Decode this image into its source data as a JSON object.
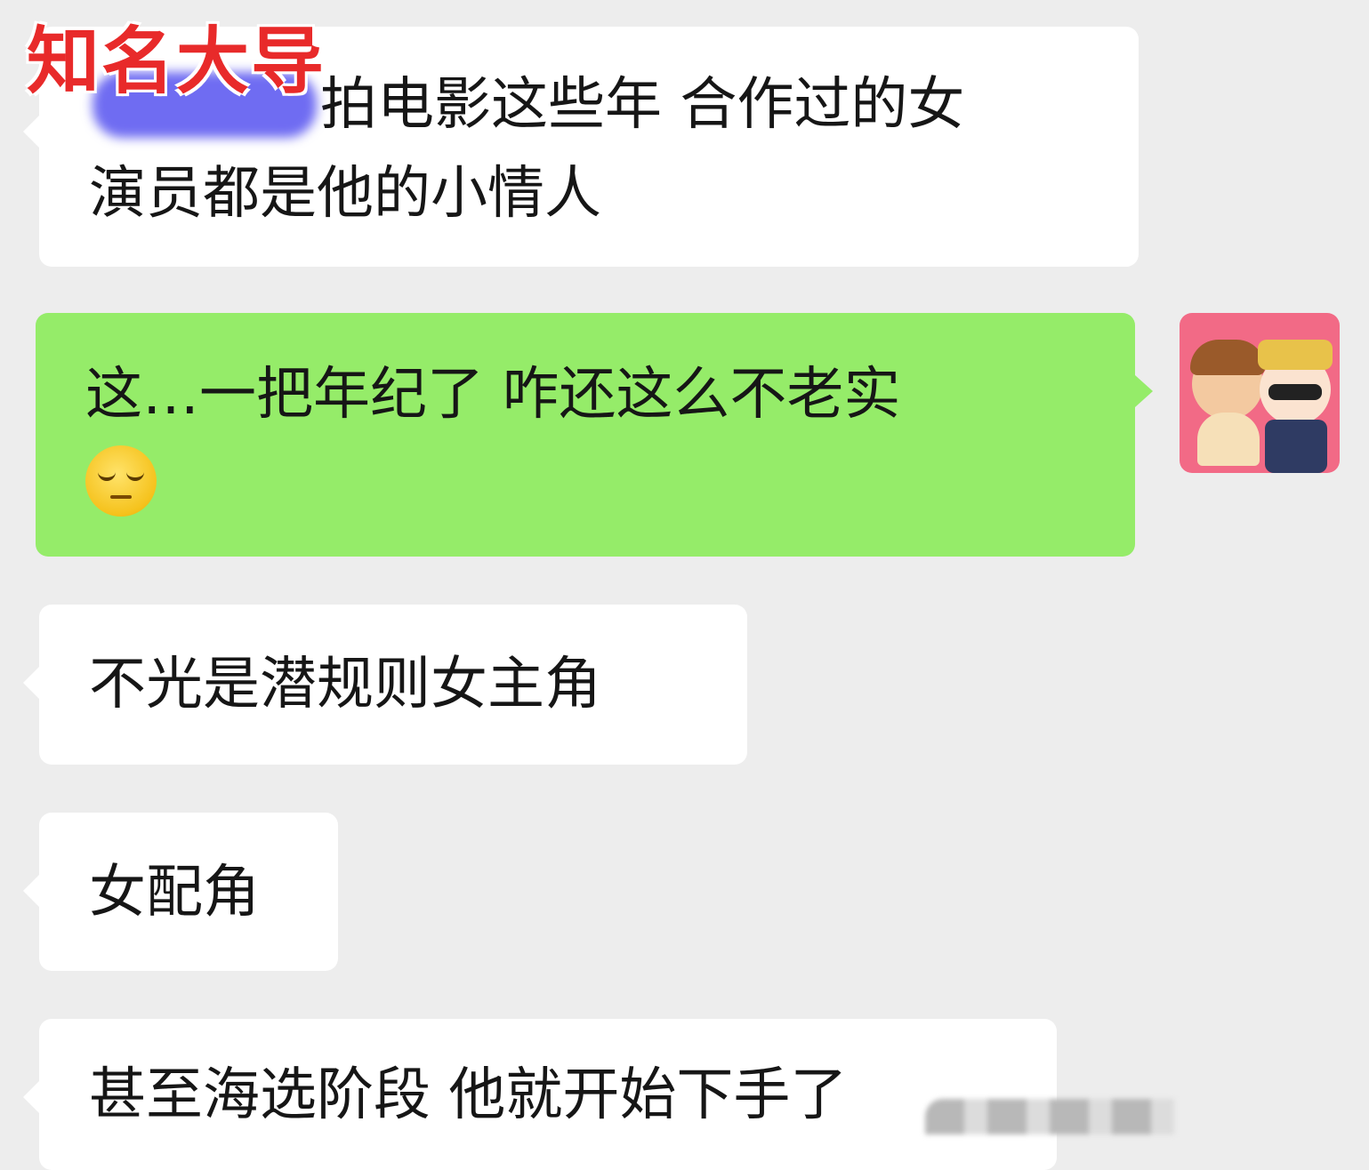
{
  "overlay": {
    "label": "知名大导"
  },
  "messages": [
    {
      "id": "m1",
      "side": "left",
      "line1": "拍电影这些年 合作过的女",
      "line2": "演员都是他的小情人"
    },
    {
      "id": "m2",
      "side": "right",
      "line1": "这…一把年纪了 咋还这么不老实",
      "emoji": "smirk-face-icon"
    },
    {
      "id": "m3",
      "side": "left",
      "text": "不光是潜规则女主角"
    },
    {
      "id": "m4",
      "side": "left",
      "text": "女配角"
    },
    {
      "id": "m5",
      "side": "left",
      "text": "甚至海选阶段 他就开始下手了"
    }
  ],
  "colors": {
    "background": "#ededed",
    "incoming_bubble": "#ffffff",
    "outgoing_bubble": "#95ec69",
    "overlay_label": "#e82a2a",
    "redaction": "#6f6cf2",
    "avatar_bg": "#f26a86"
  }
}
